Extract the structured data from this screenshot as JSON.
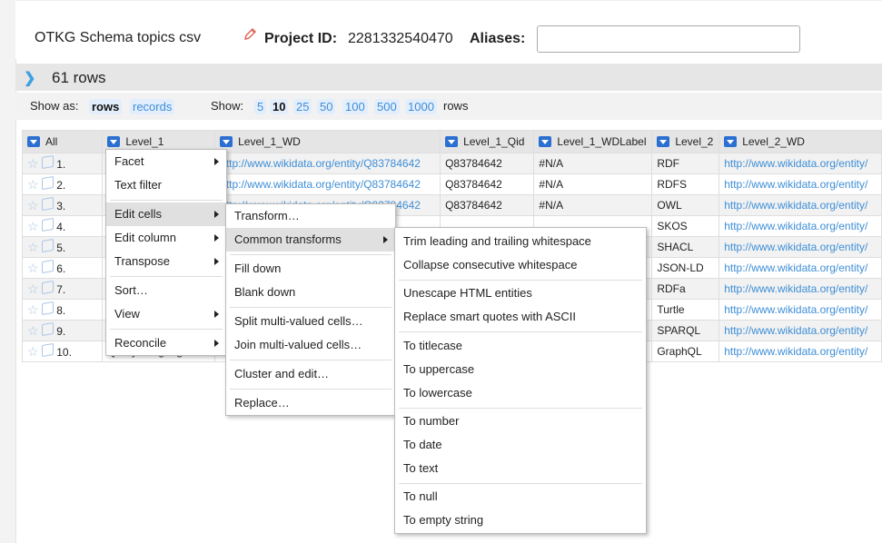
{
  "project": {
    "name": "OTKG Schema topics csv",
    "id_label": "Project ID:",
    "id_value": "2281332540470",
    "aliases_label": "Aliases:",
    "aliases_value": ""
  },
  "rows_header": {
    "count": "61 rows"
  },
  "show_as": {
    "label": "Show as:",
    "rows": "rows",
    "records": "records",
    "show_label": "Show:",
    "sizes": [
      "5",
      "10",
      "25",
      "50",
      "100",
      "500",
      "1000"
    ],
    "suffix": "rows"
  },
  "columns": [
    "All",
    "Level_1",
    "Level_1_WD",
    "Level_1_Qid",
    "Level_1_WDLabel",
    "Level_2",
    "Level_2_WD"
  ],
  "rows": [
    {
      "n": "1.",
      "l1": "",
      "wd": "http://www.wikidata.org/entity/Q83784642",
      "qid": "Q83784642",
      "label": "#N/A",
      "l2": "RDF",
      "l2wd": "http://www.wikidata.org/entity/"
    },
    {
      "n": "2.",
      "l1": "",
      "wd": "http://www.wikidata.org/entity/Q83784642",
      "qid": "Q83784642",
      "label": "#N/A",
      "l2": "RDFS",
      "l2wd": "http://www.wikidata.org/entity/"
    },
    {
      "n": "3.",
      "l1": "",
      "wd": "http://www.wikidata.org/entity/Q83784642",
      "qid": "Q83784642",
      "label": "#N/A",
      "l2": "OWL",
      "l2wd": "http://www.wikidata.org/entity/"
    },
    {
      "n": "4.",
      "l1": "",
      "wd": "",
      "qid": "",
      "label": "",
      "l2": "SKOS",
      "l2wd": "http://www.wikidata.org/entity/"
    },
    {
      "n": "5.",
      "l1": "",
      "wd": "",
      "qid": "",
      "label": "",
      "l2": "SHACL",
      "l2wd": "http://www.wikidata.org/entity/"
    },
    {
      "n": "6.",
      "l1": "",
      "wd": "",
      "qid": "",
      "label": "",
      "l2": "JSON-LD",
      "l2wd": "http://www.wikidata.org/entity/"
    },
    {
      "n": "7.",
      "l1": "",
      "wd": "",
      "qid": "",
      "label": "",
      "l2": "RDFa",
      "l2wd": "http://www.wikidata.org/entity/"
    },
    {
      "n": "8.",
      "l1": "",
      "wd": "",
      "qid": "",
      "label": "",
      "l2": "Turtle",
      "l2wd": "http://www.wikidata.org/entity/"
    },
    {
      "n": "9.",
      "l1": "",
      "wd": "",
      "qid": "",
      "label": "",
      "l2": "SPARQL",
      "l2wd": "http://www.wikidata.org/entity/"
    },
    {
      "n": "10.",
      "l1": "Query Languages",
      "wd": "",
      "qid": "",
      "label": "",
      "l2": "GraphQL",
      "l2wd": "http://www.wikidata.org/entity/"
    }
  ],
  "menu1": [
    "Facet",
    "Text filter",
    "Edit cells",
    "Edit column",
    "Transpose",
    "Sort…",
    "View",
    "Reconcile"
  ],
  "menu2": [
    "Transform…",
    "Common transforms",
    "Fill down",
    "Blank down",
    "Split multi-valued cells…",
    "Join multi-valued cells…",
    "Cluster and edit…",
    "Replace…"
  ],
  "menu3": [
    "Trim leading and trailing whitespace",
    "Collapse consecutive whitespace",
    "Unescape HTML entities",
    "Replace smart quotes with ASCII",
    "To titlecase",
    "To uppercase",
    "To lowercase",
    "To number",
    "To date",
    "To text",
    "To null",
    "To empty string"
  ]
}
